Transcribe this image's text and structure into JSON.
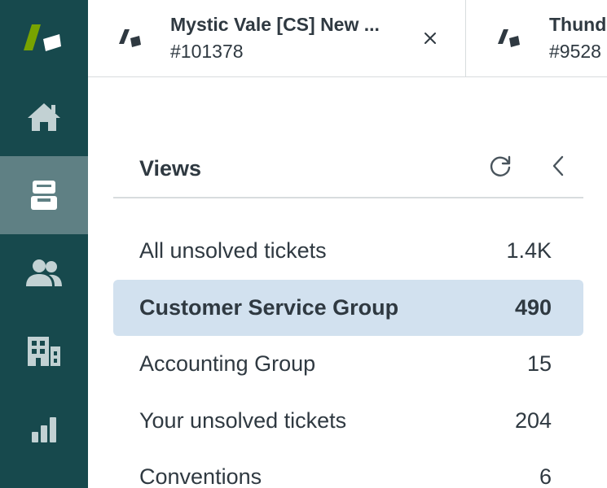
{
  "nav": {
    "items": [
      {
        "name": "home",
        "icon": "home-icon"
      },
      {
        "name": "views",
        "icon": "inbox-icon",
        "active": true
      },
      {
        "name": "customers",
        "icon": "users-icon"
      },
      {
        "name": "organizations",
        "icon": "building-icon"
      },
      {
        "name": "reporting",
        "icon": "bar-chart-icon"
      }
    ],
    "colors": {
      "rail": "#17494d",
      "active": "#5f8084",
      "icon": "#c2d1d3",
      "logo_green": "#78a300"
    }
  },
  "tabs": [
    {
      "title": "Mystic Vale [CS] New ...",
      "id": "#101378"
    },
    {
      "title": "Thund",
      "id": "#9528"
    }
  ],
  "views": {
    "title": "Views",
    "rows": [
      {
        "label": "All unsolved tickets",
        "count": "1.4K"
      },
      {
        "label": "Customer Service Group",
        "count": "490"
      },
      {
        "label": "Accounting Group",
        "count": "15"
      },
      {
        "label": "Your unsolved tickets",
        "count": "204"
      },
      {
        "label": "Conventions",
        "count": "6"
      }
    ],
    "selected_color": "#d2e1ef"
  }
}
